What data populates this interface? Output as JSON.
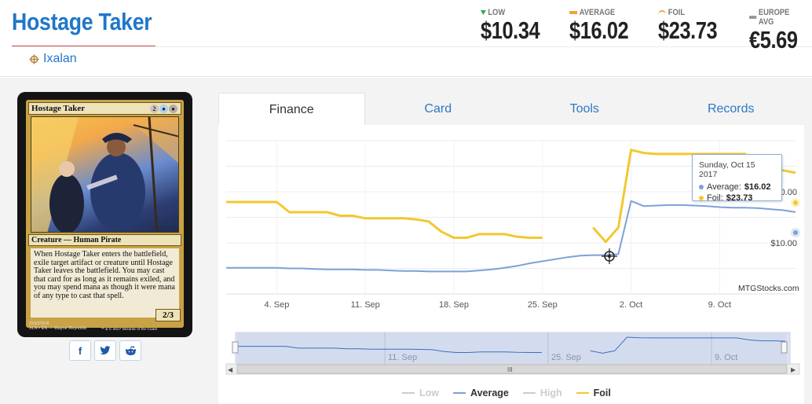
{
  "header": {
    "title": "Hostage Taker",
    "set_name": "Ixalan",
    "prices": [
      {
        "key": "low",
        "label": "LOW",
        "value": "$10.34",
        "indicator_color": "#2ea94a"
      },
      {
        "key": "average",
        "label": "AVERAGE",
        "value": "$16.02",
        "indicator_color": "#f0a33a"
      },
      {
        "key": "foil",
        "label": "FOIL",
        "value": "$23.73",
        "indicator_color": "#f0a33a"
      },
      {
        "key": "europe",
        "label": "EUROPE AVG",
        "value": "€5.69",
        "indicator_color": "#999999"
      }
    ]
  },
  "card": {
    "name": "Hostage Taker",
    "mana_cost": [
      "2",
      "U",
      "B"
    ],
    "type_line": "Creature — Human Pirate",
    "rules_text": "When Hostage Taker enters the battlefield, exile target artifact or creature until Hostage Taker leaves the battlefield. You may cast that card for as long as it remains exiled, and you may spend mana as though it were mana of any type to cast that spell.",
    "power_toughness": "2/3",
    "collector_line": "223/279 R",
    "set_line": "XLN • EN",
    "artist": "Wayne Reynolds",
    "copyright": "™ & © 2017 Wizards of the Coast"
  },
  "share": {
    "facebook": "f",
    "twitter": "t",
    "reddit": "r"
  },
  "tabs": [
    "Finance",
    "Card",
    "Tools",
    "Records"
  ],
  "active_tab": "Finance",
  "tooltip": {
    "date": "Sunday, Oct 15 2017",
    "average_label": "Average:",
    "average_value": "$16.02",
    "foil_label": "Foil:",
    "foil_value": "$23.73"
  },
  "watermark": "MTGStocks.com",
  "navigator_labels": [
    "11. Sep",
    "25. Sep",
    "9. Oct"
  ],
  "chart_data": {
    "type": "line",
    "x_tick_labels": [
      "4. Sep",
      "11. Sep",
      "18. Sep",
      "25. Sep",
      "2. Oct",
      "9. Oct"
    ],
    "y_tick_labels": [
      "$10.00",
      "$20.00"
    ],
    "ylim": [
      0,
      30
    ],
    "grid": true,
    "legend_position": "bottom",
    "legend": [
      {
        "name": "Low",
        "color": "#cccccc",
        "visible": false
      },
      {
        "name": "Average",
        "color": "#7ca1d8",
        "visible": true
      },
      {
        "name": "High",
        "color": "#cccccc",
        "visible": false
      },
      {
        "name": "Foil",
        "color": "#f3c82f",
        "visible": true
      }
    ],
    "x": [
      "Aug 31",
      "Sep 1",
      "Sep 2",
      "Sep 3",
      "Sep 4",
      "Sep 5",
      "Sep 6",
      "Sep 7",
      "Sep 8",
      "Sep 9",
      "Sep 10",
      "Sep 11",
      "Sep 12",
      "Sep 13",
      "Sep 14",
      "Sep 15",
      "Sep 16",
      "Sep 17",
      "Sep 18",
      "Sep 19",
      "Sep 20",
      "Sep 21",
      "Sep 22",
      "Sep 23",
      "Sep 24",
      "Sep 25",
      "Sep 26",
      "Sep 27",
      "Sep 28",
      "Sep 29",
      "Sep 30",
      "Oct 1",
      "Oct 2",
      "Oct 3",
      "Oct 4",
      "Oct 5",
      "Oct 6",
      "Oct 7",
      "Oct 8",
      "Oct 9",
      "Oct 10",
      "Oct 11",
      "Oct 12",
      "Oct 13",
      "Oct 14",
      "Oct 15"
    ],
    "series": [
      {
        "name": "Average",
        "values": [
          5.1,
          5.1,
          5.1,
          5.1,
          5.1,
          5.0,
          5.0,
          4.9,
          4.8,
          4.8,
          4.8,
          4.7,
          4.7,
          4.6,
          4.5,
          4.5,
          4.4,
          4.4,
          4.4,
          4.4,
          4.6,
          4.8,
          5.1,
          5.5,
          6.0,
          6.4,
          6.8,
          7.2,
          7.5,
          7.6,
          7.6,
          7.8,
          18.2,
          17.2,
          17.3,
          17.4,
          17.4,
          17.3,
          17.2,
          17.0,
          16.9,
          16.9,
          16.8,
          16.6,
          16.4,
          16.02
        ]
      },
      {
        "name": "Foil",
        "values": [
          18.0,
          18.0,
          18.0,
          18.0,
          18.0,
          16.0,
          16.0,
          16.0,
          16.0,
          15.3,
          15.3,
          14.8,
          14.8,
          14.8,
          14.8,
          14.6,
          14.2,
          12.2,
          11.0,
          11.0,
          11.7,
          11.7,
          11.7,
          11.2,
          11.0,
          11.0,
          null,
          null,
          null,
          13.0,
          10.2,
          13.0,
          28.2,
          27.6,
          27.4,
          27.4,
          27.4,
          27.4,
          27.4,
          27.4,
          27.4,
          27.4,
          25.2,
          24.2,
          24.2,
          23.73
        ]
      }
    ]
  }
}
